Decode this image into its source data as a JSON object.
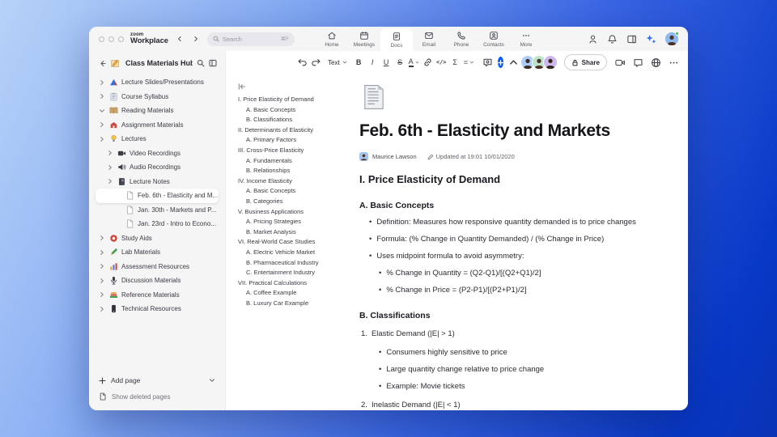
{
  "brand": {
    "top": "zoom",
    "bottom": "Workplace"
  },
  "topbar": {
    "search_placeholder": "Search",
    "search_shortcut": "⌘F",
    "tabs": [
      {
        "label": "Home",
        "icon": "home-icon",
        "active": false
      },
      {
        "label": "Meetings",
        "icon": "calendar-icon",
        "active": false
      },
      {
        "label": "Docs",
        "icon": "docs-icon",
        "active": true
      },
      {
        "label": "Email",
        "icon": "mail-icon",
        "active": false
      },
      {
        "label": "Phone",
        "icon": "phone-icon",
        "active": false
      },
      {
        "label": "Contacts",
        "icon": "contacts-icon",
        "active": false
      },
      {
        "label": "More",
        "icon": "more-dots-icon",
        "active": false
      }
    ]
  },
  "sidebar": {
    "title": "Class Materials Hub",
    "tree": [
      {
        "label": "Lecture Slides/Presentations",
        "icon": "presentation-icon",
        "level": 0,
        "chevron": "right"
      },
      {
        "label": "Course Syllabus",
        "icon": "clipboard-icon",
        "level": 0,
        "chevron": "right"
      },
      {
        "label": "Reading Materials",
        "icon": "book-icon",
        "level": 0,
        "chevron": "down"
      },
      {
        "label": "Assignment Materials",
        "icon": "school-icon",
        "level": 0,
        "chevron": "right"
      },
      {
        "label": "Lectures",
        "icon": "bulb-icon",
        "level": 0,
        "chevron": "right"
      },
      {
        "label": "Video Recordings",
        "icon": "video-icon",
        "level": 1,
        "chevron": "right"
      },
      {
        "label": "Audio Recordings",
        "icon": "speaker-icon",
        "level": 1,
        "chevron": "right"
      },
      {
        "label": "Lecture Notes",
        "icon": "notebook-icon",
        "level": 1,
        "chevron": "right"
      },
      {
        "label": "Feb. 6th - Elasticity and M...",
        "icon": "page-icon",
        "level": 2,
        "selected": true
      },
      {
        "label": "Jan. 30th - Markets and P...",
        "icon": "page-icon",
        "level": 2,
        "selected": false
      },
      {
        "label": "Jan. 23rd - Intro to Econo...",
        "icon": "page-icon",
        "level": 2,
        "selected": false
      },
      {
        "label": "Study Aids",
        "icon": "lifebuoy-icon",
        "level": 0,
        "chevron": "right"
      },
      {
        "label": "Lab Materials",
        "icon": "pencil-icon",
        "level": 0,
        "chevron": "right"
      },
      {
        "label": "Assessment Resources",
        "icon": "chart-icon",
        "level": 0,
        "chevron": "right"
      },
      {
        "label": "Discussion Materials",
        "icon": "mic-icon",
        "level": 0,
        "chevron": "right"
      },
      {
        "label": "Reference Materials",
        "icon": "books-icon",
        "level": 0,
        "chevron": "right"
      },
      {
        "label": "Technical Resources",
        "icon": "device-icon",
        "level": 0,
        "chevron": "right"
      }
    ],
    "add_page": "Add page",
    "show_deleted": "Show deleted pages"
  },
  "doc_toolbar": {
    "style_selector": "Text",
    "bold": "B",
    "italic": "I",
    "underline": "U",
    "strikethrough": "S",
    "text_color": "A",
    "code": "</>",
    "equation": "Σ",
    "share_label": "Share"
  },
  "outline": {
    "items": [
      {
        "text": "I. Price Elasticity of Demand",
        "level": 0
      },
      {
        "text": "A. Basic Concepts",
        "level": 1
      },
      {
        "text": "B. Classifications",
        "level": 1
      },
      {
        "text": "II. Determinants of Elasticity",
        "level": 0
      },
      {
        "text": "A. Primary Factors",
        "level": 1
      },
      {
        "text": "III. Cross-Price Elasticity",
        "level": 0
      },
      {
        "text": "A. Fundamentals",
        "level": 1
      },
      {
        "text": "B. Relationships",
        "level": 1
      },
      {
        "text": "IV. Income Elasticity",
        "level": 0
      },
      {
        "text": "A. Basic Concepts",
        "level": 1
      },
      {
        "text": "B. Categories",
        "level": 1
      },
      {
        "text": "V. Business Applications",
        "level": 0
      },
      {
        "text": "A. Pricing Strategies",
        "level": 1
      },
      {
        "text": "B. Market Analysis",
        "level": 1
      },
      {
        "text": "VI. Real-World Case Studies",
        "level": 0
      },
      {
        "text": "A. Electric Vehicle Market",
        "level": 1
      },
      {
        "text": "B. Pharmaceutical Industry",
        "level": 1
      },
      {
        "text": "C. Entertainment Industry",
        "level": 1
      },
      {
        "text": "VII. Practical Calculations",
        "level": 0
      },
      {
        "text": "A. Coffee Example",
        "level": 1
      },
      {
        "text": "B. Luxury Car Example",
        "level": 1
      }
    ]
  },
  "document": {
    "title": "Feb. 6th - Elasticity and Markets",
    "author": "Maurice Lawson",
    "updated_text": "Updated at 19:01 10/01/2020",
    "blocks": [
      {
        "type": "h2",
        "text": "I. Price Elasticity of Demand"
      },
      {
        "type": "h3",
        "text": "A. Basic Concepts"
      },
      {
        "type": "bullet",
        "level": 1,
        "text": "Definition: Measures how responsive quantity demanded is to price changes"
      },
      {
        "type": "bullet",
        "level": 1,
        "text": "Formula: (% Change in Quantity Demanded) / (% Change in Price)"
      },
      {
        "type": "bullet",
        "level": 1,
        "text": "Uses midpoint formula to avoid asymmetry:"
      },
      {
        "type": "bullet",
        "level": 2,
        "text": "% Change in Quantity = (Q2-Q1)/[(Q2+Q1)/2]"
      },
      {
        "type": "bullet",
        "level": 2,
        "text": "% Change in Price = (P2-P1)/[(P2+P1)/2]"
      },
      {
        "type": "h3",
        "text": "B. Classifications"
      },
      {
        "type": "num",
        "marker": "1.",
        "text": "Elastic Demand (|E| > 1)"
      },
      {
        "type": "bullet",
        "level": 2,
        "text": "Consumers highly sensitive to price"
      },
      {
        "type": "bullet",
        "level": 2,
        "text": "Large quantity change relative to price change"
      },
      {
        "type": "bullet",
        "level": 2,
        "text": "Example: Movie tickets"
      },
      {
        "type": "num",
        "marker": "2.",
        "text": "Inelastic Demand (|E| < 1)"
      }
    ]
  },
  "colors": {
    "accent_blue": "#0b5cff",
    "chrome_gray": "#f5f5f6",
    "gradient_start": "#b7d2f8",
    "gradient_end": "#0838c6"
  }
}
